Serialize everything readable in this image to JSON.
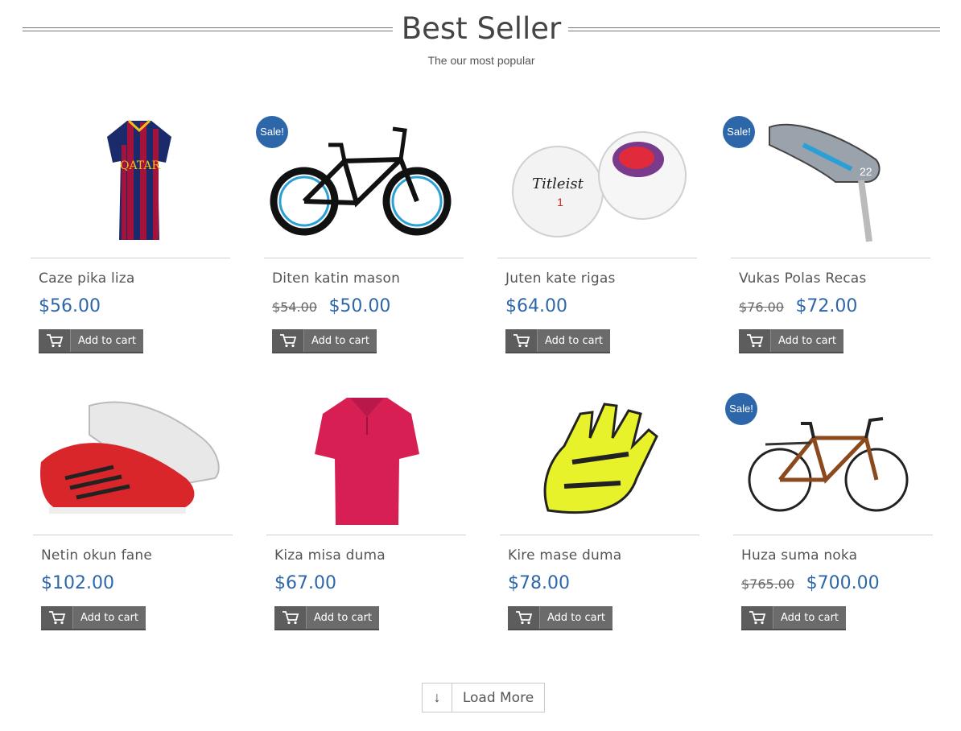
{
  "section": {
    "title": "Best Seller",
    "subtitle": "The our most popular"
  },
  "products": [
    {
      "name": "Caze pika liza",
      "price": "$56.00",
      "old_price": "",
      "sale_label": "",
      "cart_label": "Add to cart",
      "image": "soccer-jersey"
    },
    {
      "name": "Diten katin mason",
      "price": "$50.00",
      "old_price": "$54.00",
      "sale_label": "Sale!",
      "cart_label": "Add to cart",
      "image": "mountain-bike"
    },
    {
      "name": "Juten kate rigas",
      "price": "$64.00",
      "old_price": "",
      "sale_label": "",
      "cart_label": "Add to cart",
      "image": "golf-balls"
    },
    {
      "name": "Vukas Polas Recas",
      "price": "$72.00",
      "old_price": "$76.00",
      "sale_label": "Sale!",
      "cart_label": "Add to cart",
      "image": "golf-iron"
    },
    {
      "name": "Netin okun fane",
      "price": "$102.00",
      "old_price": "",
      "sale_label": "",
      "cart_label": "Add to cart",
      "image": "football-boots"
    },
    {
      "name": "Kiza misa duma",
      "price": "$67.00",
      "old_price": "",
      "sale_label": "",
      "cart_label": "Add to cart",
      "image": "polo-shirt"
    },
    {
      "name": "Kire mase duma",
      "price": "$78.00",
      "old_price": "",
      "sale_label": "",
      "cart_label": "Add to cart",
      "image": "motorcycle-glove"
    },
    {
      "name": "Huza suma noka",
      "price": "$700.00",
      "old_price": "$765.00",
      "sale_label": "Sale!",
      "cart_label": "Add to cart",
      "image": "road-bike"
    }
  ],
  "load_more": {
    "label": "Load More",
    "icon": "arrow-down-icon"
  },
  "colors": {
    "accent": "#2e67a9",
    "button": "#6b6b6b"
  }
}
